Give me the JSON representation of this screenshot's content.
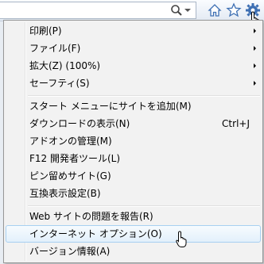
{
  "toolbar": {
    "search_icon": "search-icon",
    "dropdown_icon": "chevron-down-icon",
    "home_icon": "home-icon",
    "favorites_icon": "star-icon",
    "tools_icon": "gear-icon"
  },
  "menu": {
    "items": [
      {
        "label": "印刷(P)",
        "shortcut": "",
        "submenu": true
      },
      {
        "label": "ファイル(F)",
        "shortcut": "",
        "submenu": true
      },
      {
        "label": "拡大(Z) (100%)",
        "shortcut": "",
        "submenu": true
      },
      {
        "label": "セーフティ(S)",
        "shortcut": "",
        "submenu": true
      },
      {
        "label": "スタート メニューにサイトを追加(M)",
        "shortcut": "",
        "submenu": false
      },
      {
        "label": "ダウンロードの表示(N)",
        "shortcut": "Ctrl+J",
        "submenu": false
      },
      {
        "label": "アドオンの管理(M)",
        "shortcut": "",
        "submenu": false
      },
      {
        "label": "F12 開発者ツール(L)",
        "shortcut": "",
        "submenu": false
      },
      {
        "label": "ピン留めサイト(G)",
        "shortcut": "",
        "submenu": false
      },
      {
        "label": "互換表示設定(B)",
        "shortcut": "",
        "submenu": false
      },
      {
        "label": "Web サイトの問題を報告(R)",
        "shortcut": "",
        "submenu": false
      },
      {
        "label": "インターネット オプション(O)",
        "shortcut": "",
        "submenu": false,
        "highlighted": true
      },
      {
        "label": "バージョン情報(A)",
        "shortcut": "",
        "submenu": false
      }
    ]
  },
  "colors": {
    "menu_background": "#f2f2f2",
    "highlight_border": "#a8d0f1",
    "toolbar_icon": "#3d6fb3"
  }
}
